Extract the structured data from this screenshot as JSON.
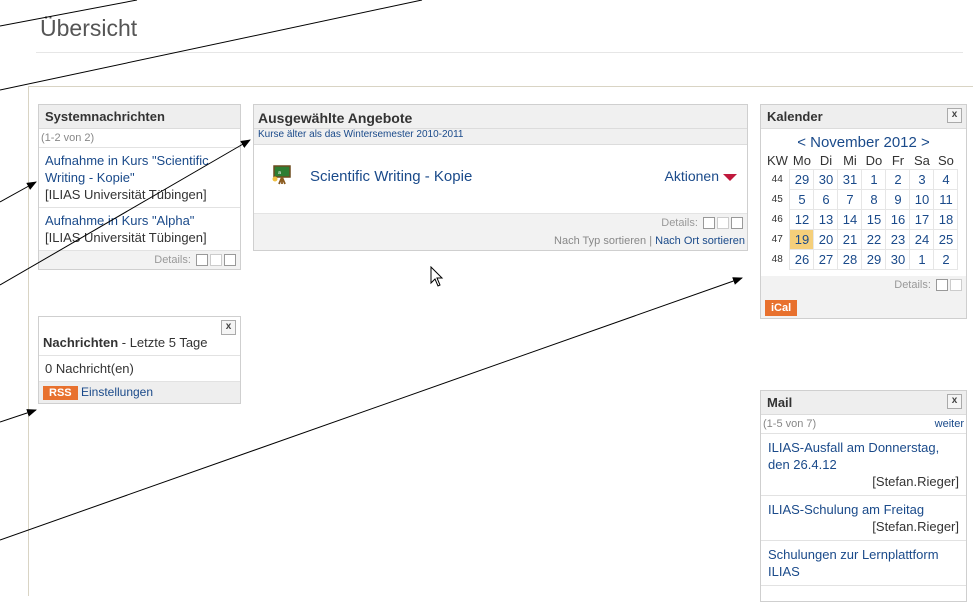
{
  "page": {
    "title": "Übersicht"
  },
  "sysmessages": {
    "title": "Systemnachrichten",
    "range": "(1-2 von 2)",
    "items": [
      {
        "text": "Aufnahme in Kurs \"Scientific Writing - Kopie\"",
        "source": "[ILIAS Universität Tübingen]"
      },
      {
        "text": "Aufnahme in Kurs \"Alpha\"",
        "source": "[ILIAS Universität Tübingen]"
      }
    ],
    "details_label": "Details:"
  },
  "offers": {
    "title": "Ausgewählte Angebote",
    "subtitle": "Kurse älter als das Wintersemester 2010-2011",
    "course": {
      "title": "Scientific Writing - Kopie",
      "actions": "Aktionen"
    },
    "details_label": "Details:",
    "sort_type": "Nach Typ sortieren",
    "sort_sep": "|",
    "sort_location": "Nach Ort sortieren"
  },
  "news": {
    "title": "Nachrichten",
    "title_suffix": " - Letzte 5 Tage",
    "count": "0 Nachricht(en)",
    "rss": "RSS",
    "settings": "Einstellungen"
  },
  "calendar": {
    "title": "Kalender",
    "prev": "<",
    "month": "November 2012",
    "next": ">",
    "headers": [
      "KW",
      "Mo",
      "Di",
      "Mi",
      "Do",
      "Fr",
      "Sa",
      "So"
    ],
    "weeks": [
      {
        "kw": "44",
        "days": [
          "29",
          "30",
          "31",
          "1",
          "2",
          "3",
          "4"
        ]
      },
      {
        "kw": "45",
        "days": [
          "5",
          "6",
          "7",
          "8",
          "9",
          "10",
          "11"
        ]
      },
      {
        "kw": "46",
        "days": [
          "12",
          "13",
          "14",
          "15",
          "16",
          "17",
          "18"
        ]
      },
      {
        "kw": "47",
        "days": [
          "19",
          "20",
          "21",
          "22",
          "23",
          "24",
          "25"
        ]
      },
      {
        "kw": "48",
        "days": [
          "26",
          "27",
          "28",
          "29",
          "30",
          "1",
          "2"
        ]
      }
    ],
    "today": "19",
    "details_label": "Details:",
    "ical": "iCal"
  },
  "mail": {
    "title": "Mail",
    "range": "(1-5 von 7)",
    "more": "weiter",
    "items": [
      {
        "subject": "ILIAS-Ausfall am Donnerstag, den 26.4.12",
        "sender": "[Stefan.Rieger]"
      },
      {
        "subject": "ILIAS-Schulung am Freitag",
        "sender": "[Stefan.Rieger]"
      },
      {
        "subject": "Schulungen zur Lernplattform ILIAS",
        "sender": ""
      }
    ]
  },
  "colors": {
    "accent_orange": "#e8712e",
    "link_blue": "#1a4a8a",
    "today_highlight": "#f5cf7a",
    "arrow_red": "#c0183c"
  }
}
